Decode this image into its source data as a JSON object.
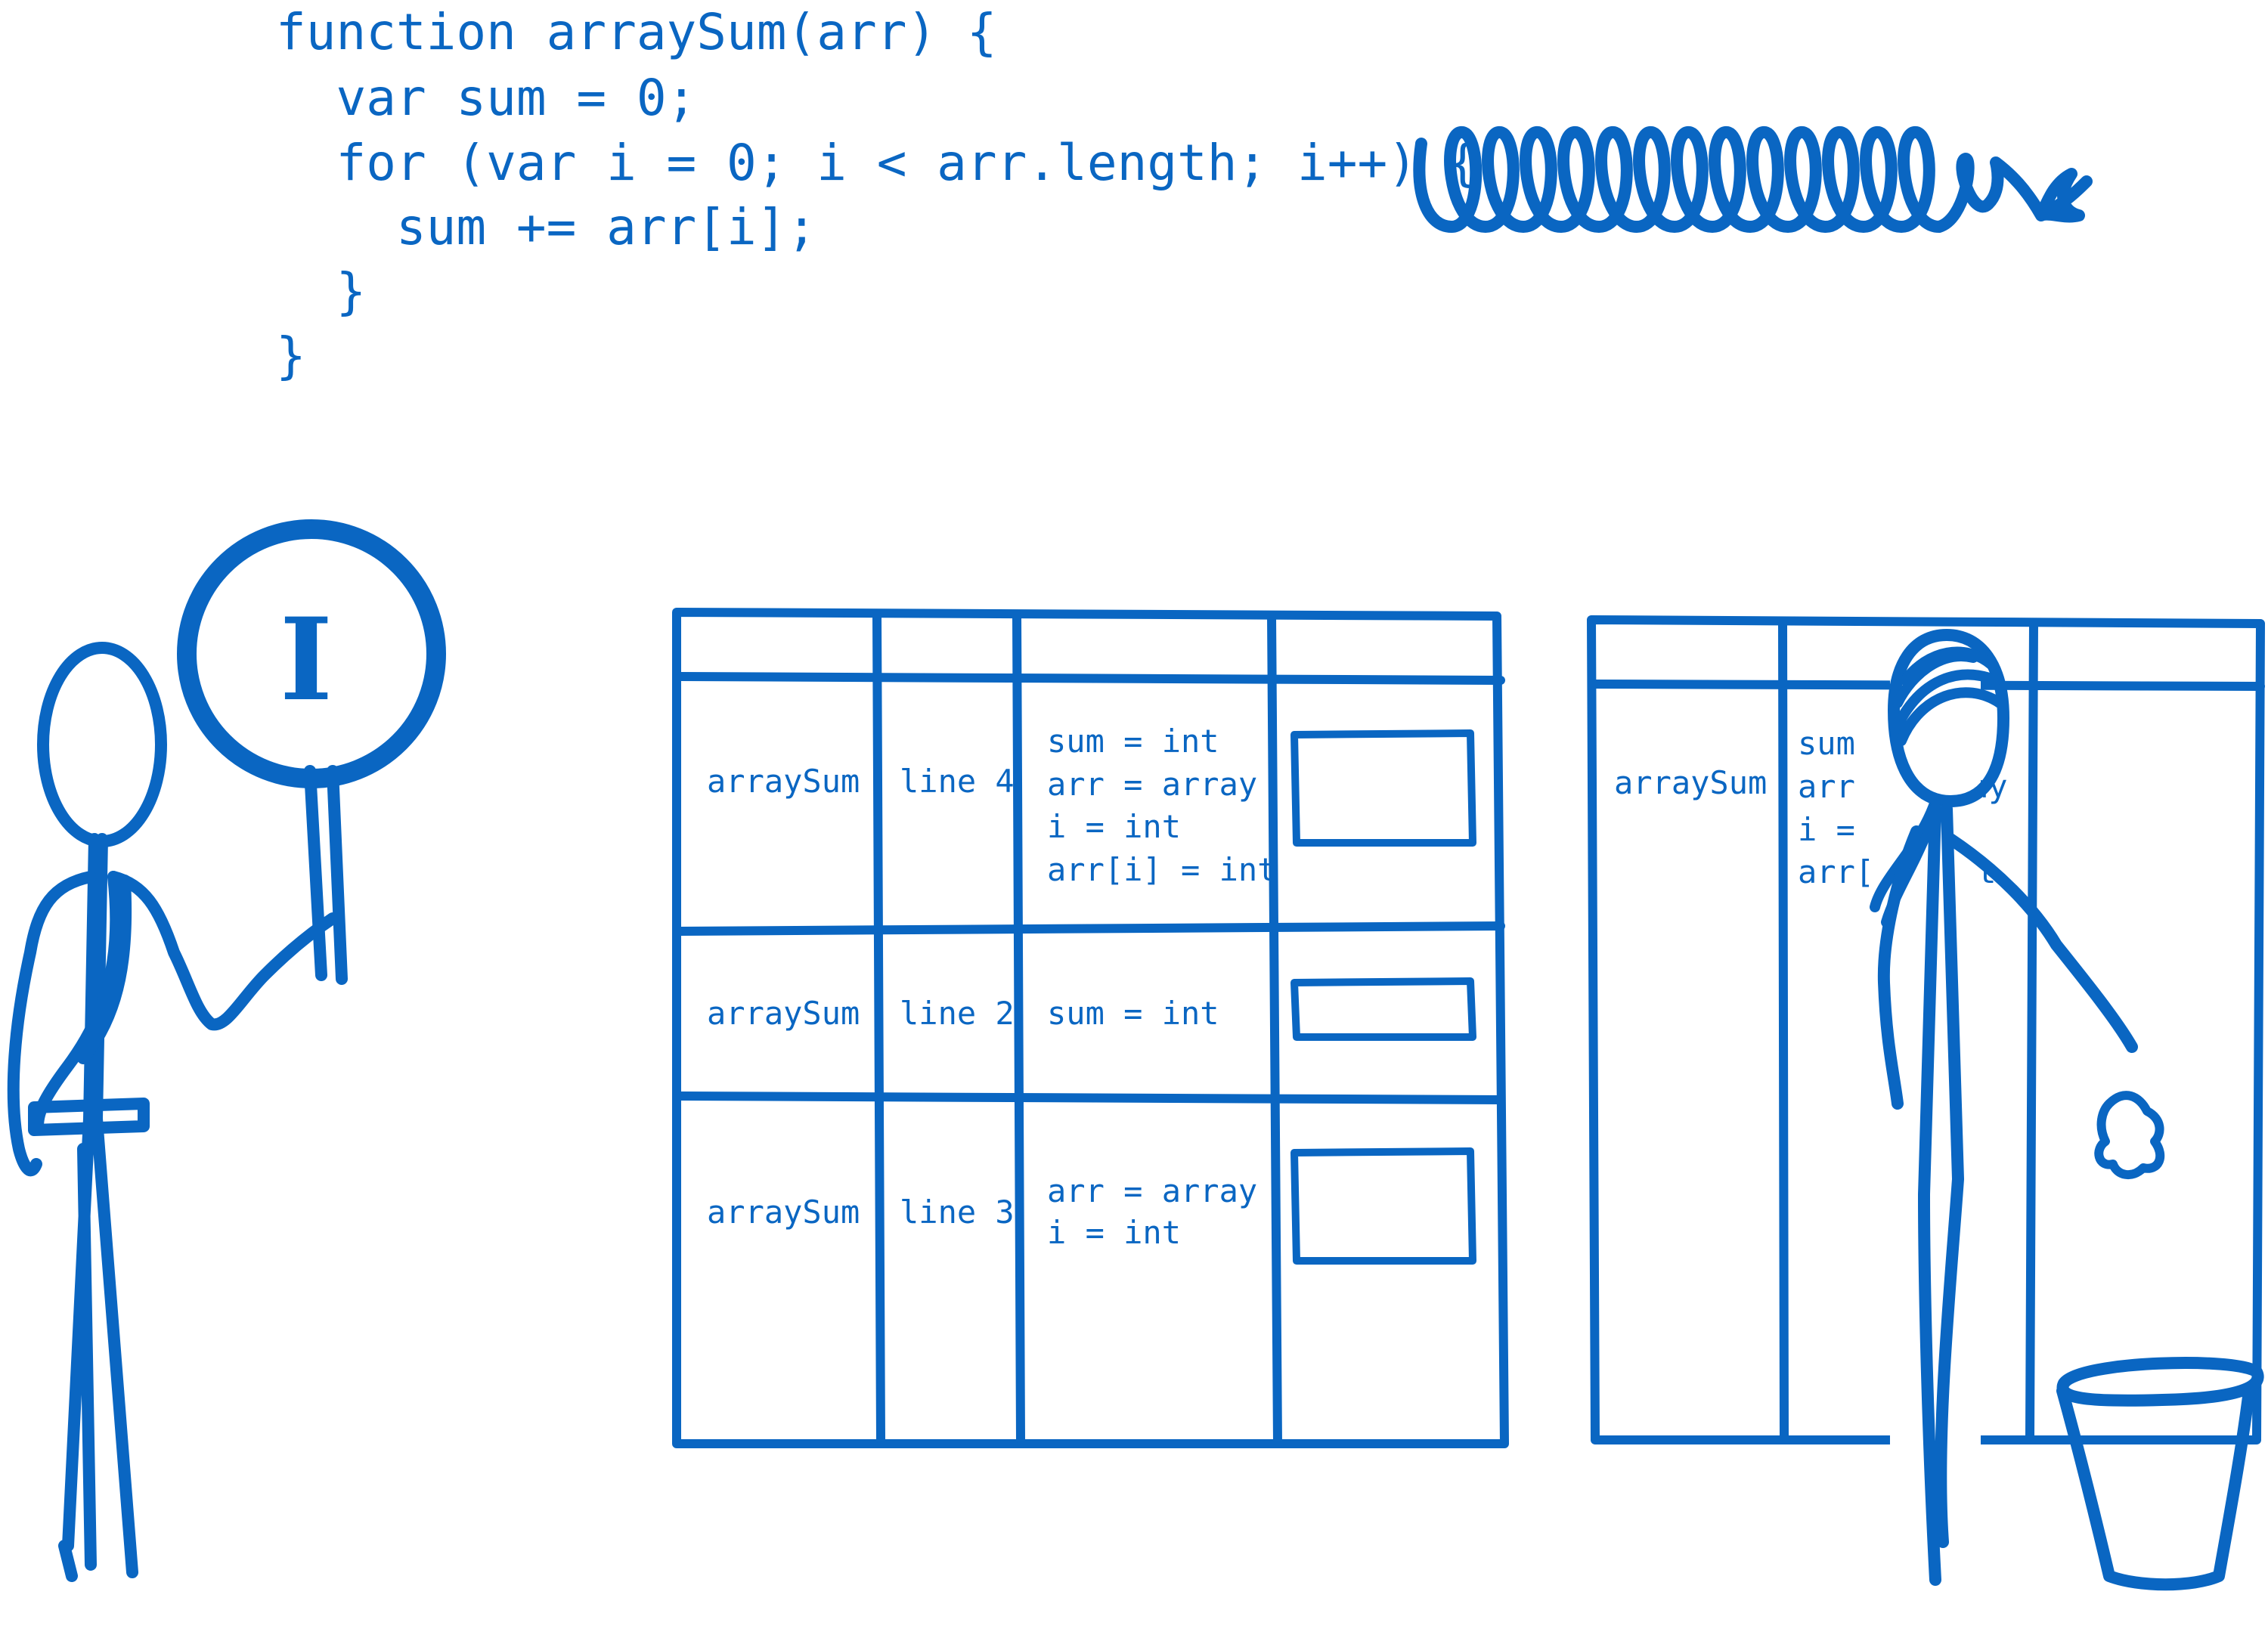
{
  "colors": {
    "ink": "#0a66c2",
    "background": "#ffffff"
  },
  "code": {
    "lines": [
      "function arraySum(arr) {",
      "  var sum = 0;",
      "  for (var i = 0; i < arr.length; i++) {",
      "    sum += arr[i];",
      "  }",
      "}"
    ]
  },
  "sign": {
    "letter": "I"
  },
  "stack_table": {
    "rows": [
      {
        "func": "arraySum",
        "line": "line 4",
        "vars": [
          "sum = int",
          "arr = array",
          "i = int",
          "arr[i] = int"
        ]
      },
      {
        "func": "arraySum",
        "line": "line 2",
        "vars": [
          "sum = int"
        ]
      },
      {
        "func": "arraySum",
        "line": "line 3",
        "vars": [
          "arr = array",
          "i = int"
        ]
      }
    ]
  },
  "right_table": {
    "func": "arraySum",
    "vars": [
      "sum",
      "arr",
      "i =",
      "arr["
    ],
    "vars_right": [
      "ay",
      "nt"
    ]
  }
}
